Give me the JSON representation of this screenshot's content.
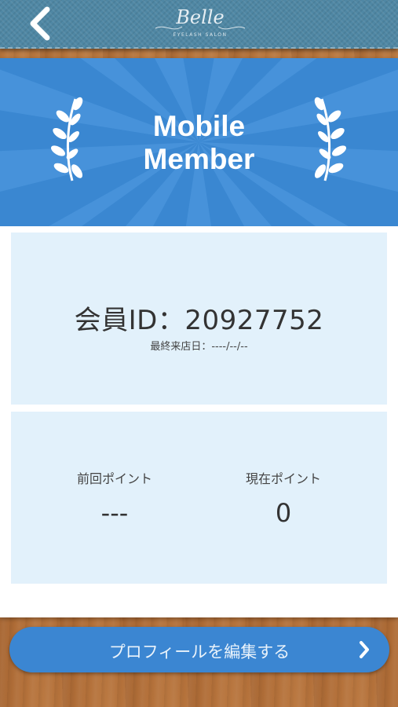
{
  "header": {
    "logo_text": "Belle",
    "logo_subtext": "EYELASH SALON"
  },
  "banner": {
    "title_line1": "Mobile",
    "title_line2": "Member"
  },
  "member": {
    "id_text": "会員ID：20927752",
    "last_visit_text": "最終来店日：----/--/--"
  },
  "points": {
    "previous_label": "前回ポイント",
    "previous_value": "---",
    "current_label": "現在ポイント",
    "current_value": "0"
  },
  "cta": {
    "label": "プロフィールを編集する"
  },
  "colors": {
    "header": "#4f87a4",
    "banner": "#3a87d1",
    "panel": "#e2f1fb",
    "button": "#3b86d2"
  }
}
